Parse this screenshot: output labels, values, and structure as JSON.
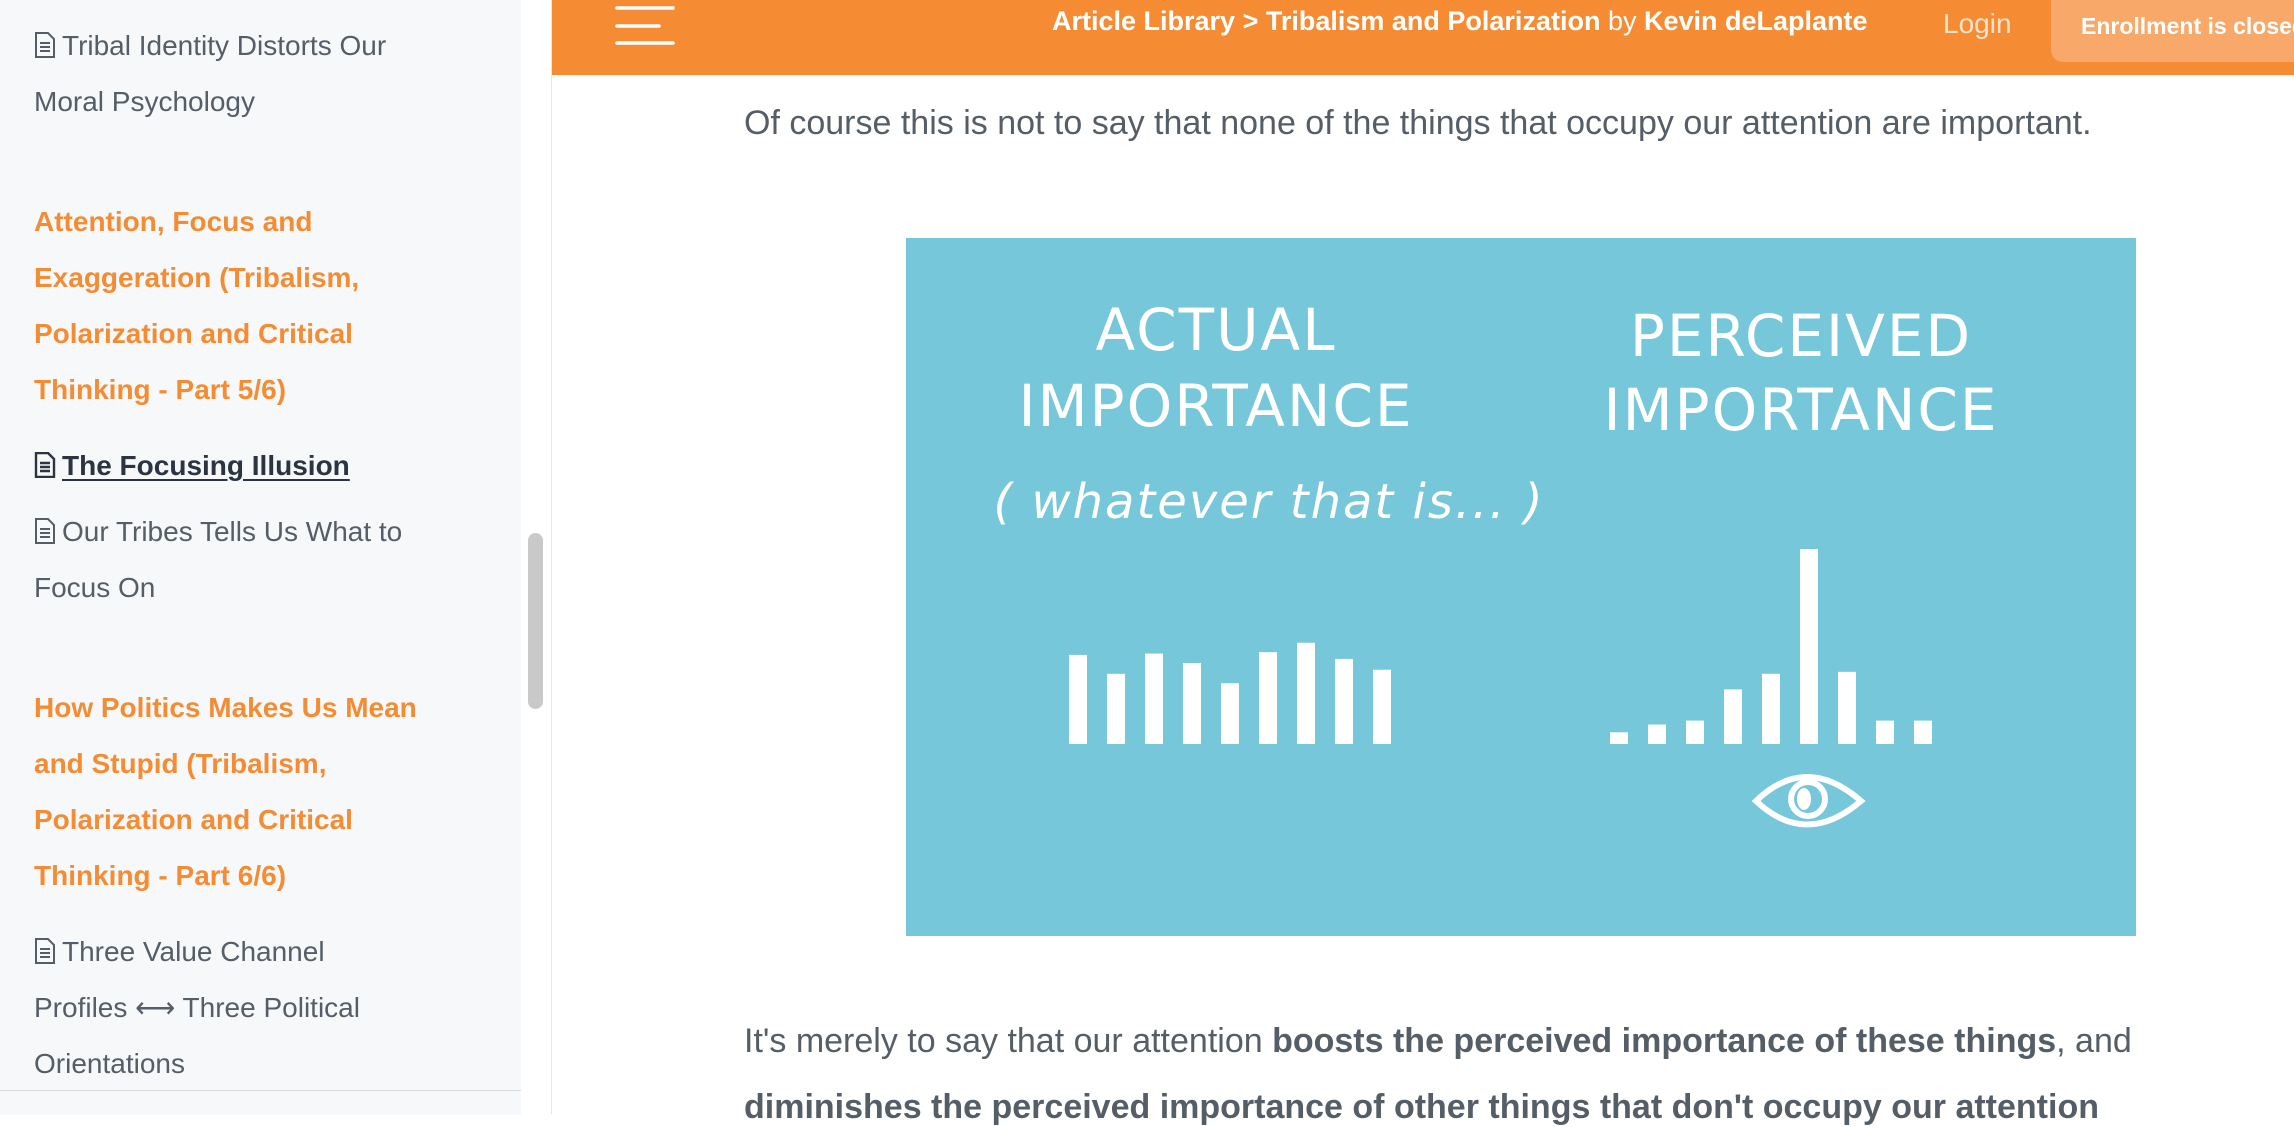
{
  "header": {
    "breadcrumb_library": "Article Library",
    "breadcrumb_sep": " > ",
    "breadcrumb_course": "Tribalism and Polarization",
    "by_word": " by ",
    "author": "Kevin deLaplante",
    "login_label": "Login",
    "enroll_label": "Enrollment is closed",
    "menu_icon": "hamburger-icon",
    "accent_color": "#f58c34"
  },
  "sidebar": {
    "items": [
      {
        "type": "lesson",
        "label_line1": "Tribal Identity Distorts Our",
        "label_line2": "Moral Psychology",
        "icon": "document-icon"
      },
      {
        "type": "section",
        "lines": [
          "Attention, Focus and",
          "Exaggeration (Tribalism,",
          "Polarization and Critical",
          "Thinking - Part 5/6)"
        ]
      },
      {
        "type": "lesson",
        "label": "The Focusing Illusion",
        "icon": "document-icon",
        "active": true
      },
      {
        "type": "lesson",
        "label_line1": "Our Tribes Tells Us What to",
        "label_line2": "Focus On",
        "icon": "document-icon"
      },
      {
        "type": "section",
        "lines": [
          "How Politics Makes Us Mean",
          "and Stupid (Tribalism,",
          "Polarization and Critical",
          "Thinking - Part 6/6)"
        ]
      },
      {
        "type": "lesson",
        "lines": [
          "Three Value Channel",
          "Profiles ⟷ Three Political",
          "Orientations"
        ],
        "icon": "document-icon"
      }
    ]
  },
  "content": {
    "para1": "Of course this is not to say that none of the things that occupy our attention are important.",
    "para2_start": "It's merely to say that our attention ",
    "para2_bold": "boosts the perceived importance of these things",
    "para2_end": ", and",
    "para3_bold": "diminishes the perceived importance of other things that don't occupy our attention",
    "figure": {
      "left_title_1": "ACTUAL",
      "left_title_2": "IMPORTANCE",
      "left_subtitle": "( whatever that is... )",
      "right_title_1": "PERCEIVED",
      "right_title_2": "IMPORTANCE",
      "actual_bars": [
        0.66,
        0.52,
        0.67,
        0.6,
        0.45,
        0.68,
        0.75,
        0.63,
        0.55
      ],
      "perceived_bars": [
        0.06,
        0.1,
        0.12,
        0.28,
        0.36,
        1.0,
        0.37,
        0.12,
        0.12
      ],
      "eye_icon": "eye-icon",
      "background_color": "#76c7d9"
    }
  }
}
